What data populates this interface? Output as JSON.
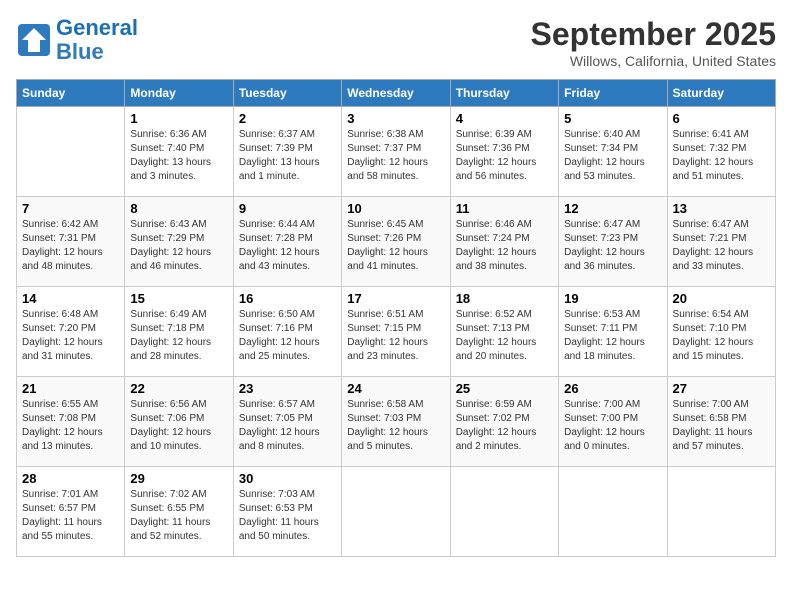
{
  "header": {
    "logo_line1": "General",
    "logo_line2": "Blue",
    "month": "September 2025",
    "location": "Willows, California, United States"
  },
  "days_of_week": [
    "Sunday",
    "Monday",
    "Tuesday",
    "Wednesday",
    "Thursday",
    "Friday",
    "Saturday"
  ],
  "weeks": [
    [
      {
        "day": "",
        "info": ""
      },
      {
        "day": "1",
        "info": "Sunrise: 6:36 AM\nSunset: 7:40 PM\nDaylight: 13 hours\nand 3 minutes."
      },
      {
        "day": "2",
        "info": "Sunrise: 6:37 AM\nSunset: 7:39 PM\nDaylight: 13 hours\nand 1 minute."
      },
      {
        "day": "3",
        "info": "Sunrise: 6:38 AM\nSunset: 7:37 PM\nDaylight: 12 hours\nand 58 minutes."
      },
      {
        "day": "4",
        "info": "Sunrise: 6:39 AM\nSunset: 7:36 PM\nDaylight: 12 hours\nand 56 minutes."
      },
      {
        "day": "5",
        "info": "Sunrise: 6:40 AM\nSunset: 7:34 PM\nDaylight: 12 hours\nand 53 minutes."
      },
      {
        "day": "6",
        "info": "Sunrise: 6:41 AM\nSunset: 7:32 PM\nDaylight: 12 hours\nand 51 minutes."
      }
    ],
    [
      {
        "day": "7",
        "info": "Sunrise: 6:42 AM\nSunset: 7:31 PM\nDaylight: 12 hours\nand 48 minutes."
      },
      {
        "day": "8",
        "info": "Sunrise: 6:43 AM\nSunset: 7:29 PM\nDaylight: 12 hours\nand 46 minutes."
      },
      {
        "day": "9",
        "info": "Sunrise: 6:44 AM\nSunset: 7:28 PM\nDaylight: 12 hours\nand 43 minutes."
      },
      {
        "day": "10",
        "info": "Sunrise: 6:45 AM\nSunset: 7:26 PM\nDaylight: 12 hours\nand 41 minutes."
      },
      {
        "day": "11",
        "info": "Sunrise: 6:46 AM\nSunset: 7:24 PM\nDaylight: 12 hours\nand 38 minutes."
      },
      {
        "day": "12",
        "info": "Sunrise: 6:47 AM\nSunset: 7:23 PM\nDaylight: 12 hours\nand 36 minutes."
      },
      {
        "day": "13",
        "info": "Sunrise: 6:47 AM\nSunset: 7:21 PM\nDaylight: 12 hours\nand 33 minutes."
      }
    ],
    [
      {
        "day": "14",
        "info": "Sunrise: 6:48 AM\nSunset: 7:20 PM\nDaylight: 12 hours\nand 31 minutes."
      },
      {
        "day": "15",
        "info": "Sunrise: 6:49 AM\nSunset: 7:18 PM\nDaylight: 12 hours\nand 28 minutes."
      },
      {
        "day": "16",
        "info": "Sunrise: 6:50 AM\nSunset: 7:16 PM\nDaylight: 12 hours\nand 25 minutes."
      },
      {
        "day": "17",
        "info": "Sunrise: 6:51 AM\nSunset: 7:15 PM\nDaylight: 12 hours\nand 23 minutes."
      },
      {
        "day": "18",
        "info": "Sunrise: 6:52 AM\nSunset: 7:13 PM\nDaylight: 12 hours\nand 20 minutes."
      },
      {
        "day": "19",
        "info": "Sunrise: 6:53 AM\nSunset: 7:11 PM\nDaylight: 12 hours\nand 18 minutes."
      },
      {
        "day": "20",
        "info": "Sunrise: 6:54 AM\nSunset: 7:10 PM\nDaylight: 12 hours\nand 15 minutes."
      }
    ],
    [
      {
        "day": "21",
        "info": "Sunrise: 6:55 AM\nSunset: 7:08 PM\nDaylight: 12 hours\nand 13 minutes."
      },
      {
        "day": "22",
        "info": "Sunrise: 6:56 AM\nSunset: 7:06 PM\nDaylight: 12 hours\nand 10 minutes."
      },
      {
        "day": "23",
        "info": "Sunrise: 6:57 AM\nSunset: 7:05 PM\nDaylight: 12 hours\nand 8 minutes."
      },
      {
        "day": "24",
        "info": "Sunrise: 6:58 AM\nSunset: 7:03 PM\nDaylight: 12 hours\nand 5 minutes."
      },
      {
        "day": "25",
        "info": "Sunrise: 6:59 AM\nSunset: 7:02 PM\nDaylight: 12 hours\nand 2 minutes."
      },
      {
        "day": "26",
        "info": "Sunrise: 7:00 AM\nSunset: 7:00 PM\nDaylight: 12 hours\nand 0 minutes."
      },
      {
        "day": "27",
        "info": "Sunrise: 7:00 AM\nSunset: 6:58 PM\nDaylight: 11 hours\nand 57 minutes."
      }
    ],
    [
      {
        "day": "28",
        "info": "Sunrise: 7:01 AM\nSunset: 6:57 PM\nDaylight: 11 hours\nand 55 minutes."
      },
      {
        "day": "29",
        "info": "Sunrise: 7:02 AM\nSunset: 6:55 PM\nDaylight: 11 hours\nand 52 minutes."
      },
      {
        "day": "30",
        "info": "Sunrise: 7:03 AM\nSunset: 6:53 PM\nDaylight: 11 hours\nand 50 minutes."
      },
      {
        "day": "",
        "info": ""
      },
      {
        "day": "",
        "info": ""
      },
      {
        "day": "",
        "info": ""
      },
      {
        "day": "",
        "info": ""
      }
    ]
  ]
}
